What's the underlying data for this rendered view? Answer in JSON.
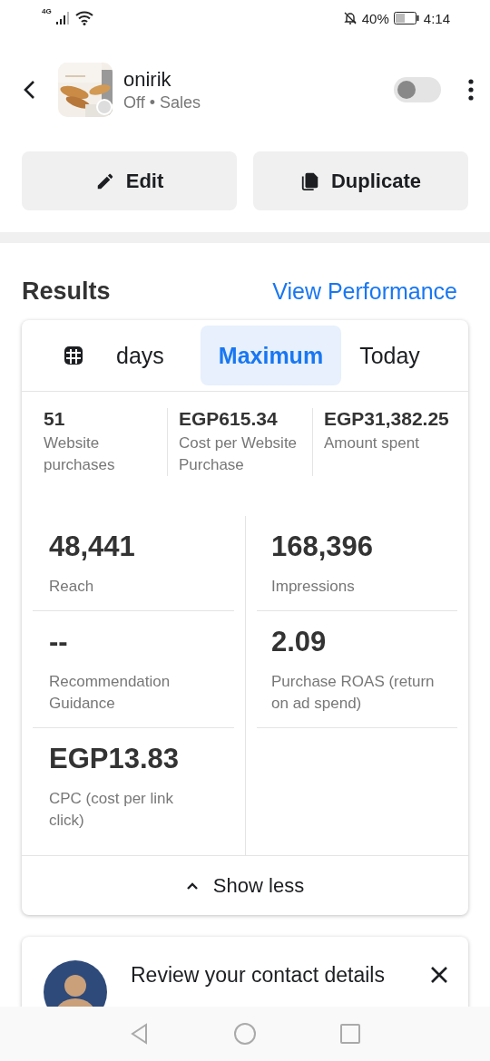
{
  "status_bar": {
    "network": "4G",
    "battery": "40%",
    "time": "4:14"
  },
  "header": {
    "title": "onirik",
    "subtitle": "Off • Sales",
    "toggle": {
      "on": false
    }
  },
  "actions": [
    {
      "label": "Edit",
      "kind": "edit"
    },
    {
      "label": "Duplicate",
      "kind": "duplicate"
    }
  ],
  "results": {
    "title": "Results",
    "link": "View Performance"
  },
  "date_tabs": [
    {
      "label": "days",
      "kind": "calendar",
      "selected": false
    },
    {
      "label": "Maximum",
      "kind": "text",
      "selected": true
    },
    {
      "label": "Today",
      "kind": "text",
      "selected": false
    }
  ],
  "summary": [
    {
      "value": "51",
      "label": "Website purchases"
    },
    {
      "value": "EGP615.34",
      "label": "Cost per Website Purchase"
    },
    {
      "value": "EGP31,382.25",
      "label": "Amount spent"
    }
  ],
  "metrics_left": [
    {
      "value": "48,441",
      "label": "Reach"
    },
    {
      "value": "--",
      "label": "Recommendation Guidance"
    },
    {
      "value": "EGP13.83",
      "label": "CPC (cost per link click)"
    }
  ],
  "metrics_right": [
    {
      "value": "168,396",
      "label": "Impressions"
    },
    {
      "value": "2.09",
      "label": "Purchase ROAS (return on ad spend)"
    }
  ],
  "show_toggle": {
    "label": "Show less",
    "expanded": true
  },
  "notice": {
    "text": "Review your contact details"
  }
}
